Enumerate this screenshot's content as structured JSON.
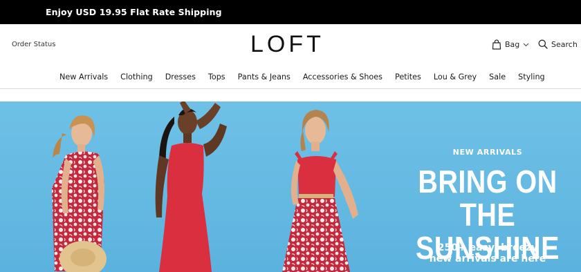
{
  "promo": {
    "text": "Enjoy USD 19.95 Flat Rate Shipping"
  },
  "header": {
    "order_status": "Order Status",
    "logo": "LOFT",
    "bag_label": "Bag",
    "search_label": "Search"
  },
  "nav": {
    "items": [
      "New Arrivals",
      "Clothing",
      "Dresses",
      "Tops",
      "Pants & Jeans",
      "Accessories & Shoes",
      "Petites",
      "Lou & Grey",
      "Sale",
      "Styling"
    ]
  },
  "hero": {
    "eyebrow": "NEW ARRIVALS",
    "headline_line1": "BRING ON",
    "headline_line2": "THE SUNSHINE",
    "subhead_line1": "250+ easy, breezy",
    "subhead_line2": "new arrivals are here",
    "colors": {
      "background": "#64b9e2",
      "dress_red": "#d92f3e",
      "print_white": "#ffffff"
    }
  },
  "icons": {
    "bag": "shopping-bag-icon",
    "chevron": "chevron-down-icon",
    "search": "search-icon"
  }
}
